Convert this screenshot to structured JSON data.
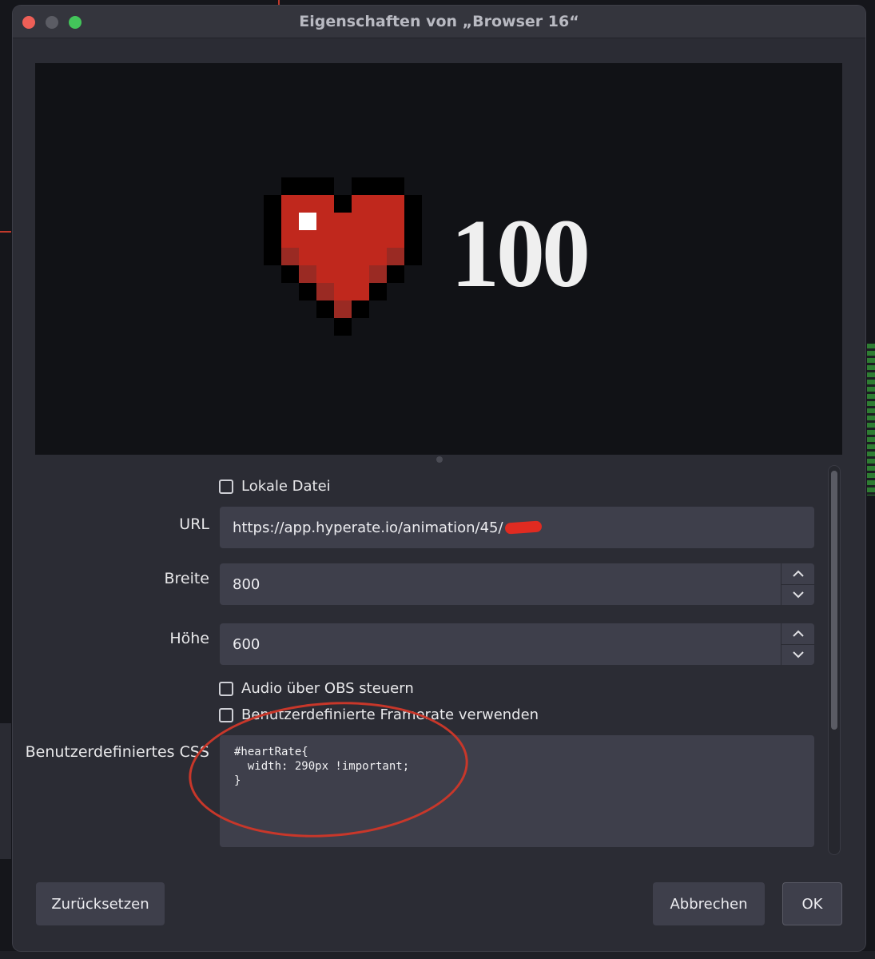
{
  "window": {
    "title": "Eigenschaften von „Browser 16“"
  },
  "preview": {
    "heart_rate_value": "100"
  },
  "form": {
    "local_file_label": "Lokale Datei",
    "url_label": "URL",
    "url_value": "https://app.hyperate.io/animation/45/",
    "width_label": "Breite",
    "width_value": "800",
    "height_label": "Höhe",
    "height_value": "600",
    "audio_label": "Audio über OBS steuern",
    "framerate_label": "Benutzerdefinierte Framerate verwenden",
    "css_label": "Benutzerdefiniertes CSS",
    "css_value": "#heartRate{\n  width: 290px !important;\n}"
  },
  "buttons": {
    "reset": "Zurücksetzen",
    "cancel": "Abbrechen",
    "ok": "OK"
  },
  "colors": {
    "heart": "#c0281d",
    "annotation": "#c8372a",
    "redaction": "#e02b21"
  },
  "icons": {
    "spin_up": "chevron-up-icon",
    "spin_down": "chevron-down-icon"
  }
}
